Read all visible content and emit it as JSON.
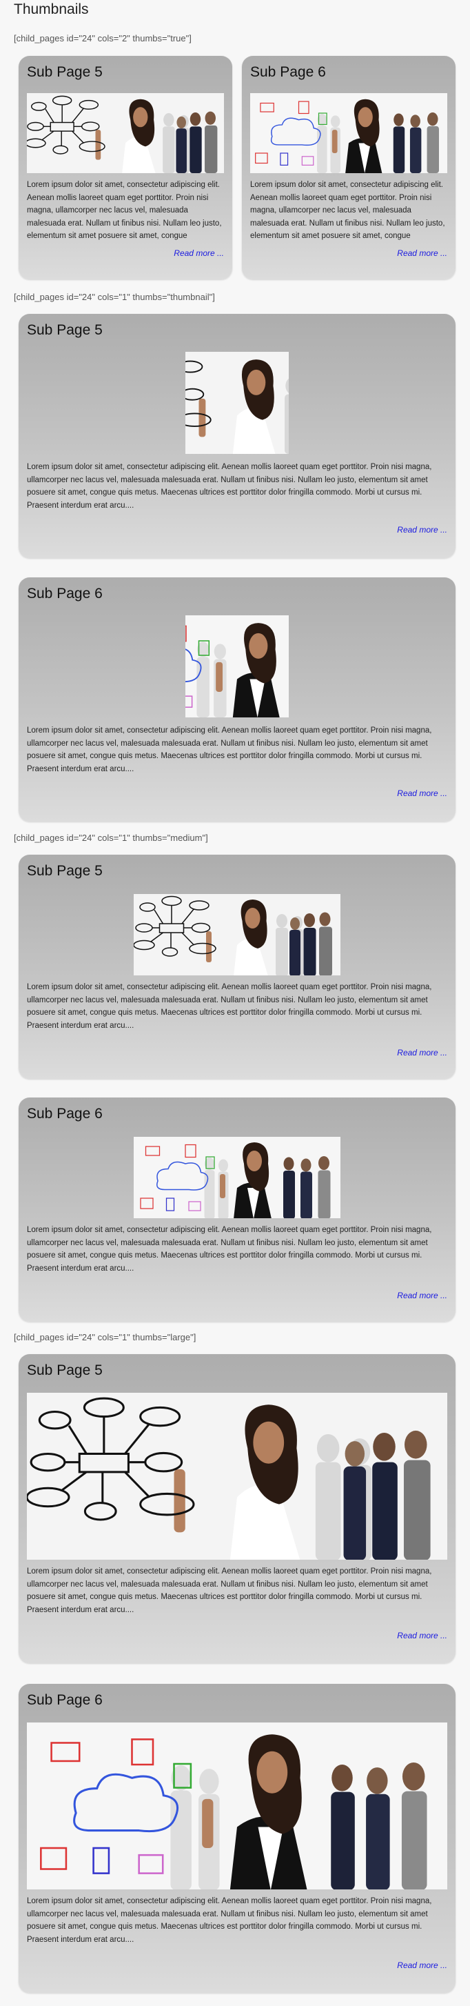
{
  "page": {
    "title": "Thumbnails"
  },
  "shortcodes": {
    "s1": "[child_pages id=\"24\" cols=\"2\" thumbs=\"true\"]",
    "s2": "[child_pages id=\"24\" cols=\"1\" thumbs=\"thumbnail\"]",
    "s3": "[child_pages id=\"24\" cols=\"1\" thumbs=\"medium\"]",
    "s4": "[child_pages id=\"24\" cols=\"1\" thumbs=\"large\"]"
  },
  "pages": {
    "sub5": {
      "title": "Sub Page 5",
      "image": "website-diagram-woman-photo"
    },
    "sub6": {
      "title": "Sub Page 6",
      "image": "cloud-diagram-woman-photo"
    }
  },
  "excerpt_short": "Lorem ipsum dolor sit amet, consectetur adipiscing elit. Aenean mollis laoreet quam eget porttitor. Proin nisi magna, ullamcorper nec lacus vel, malesuada malesuada erat. Nullam ut finibus nisi. Nullam leo justo, elementum sit amet posuere sit amet, congue",
  "excerpt_long": "Lorem ipsum dolor sit amet, consectetur adipiscing elit. Aenean mollis laoreet quam eget porttitor. Proin nisi magna, ullamcorper nec lacus vel, malesuada malesuada erat. Nullam ut finibus nisi. Nullam leo justo, elementum sit amet posuere sit amet, congue quis metus. Maecenas ultrices est porttitor dolor fringilla commodo. Morbi ut cursus mi. Praesent interdum erat arcu....",
  "read_more": "Read more ...",
  "colors": {
    "link": "#1a1ae0",
    "card_top": "#adadad",
    "card_bottom": "#dcdcdc",
    "background": "#f7f7f7"
  }
}
